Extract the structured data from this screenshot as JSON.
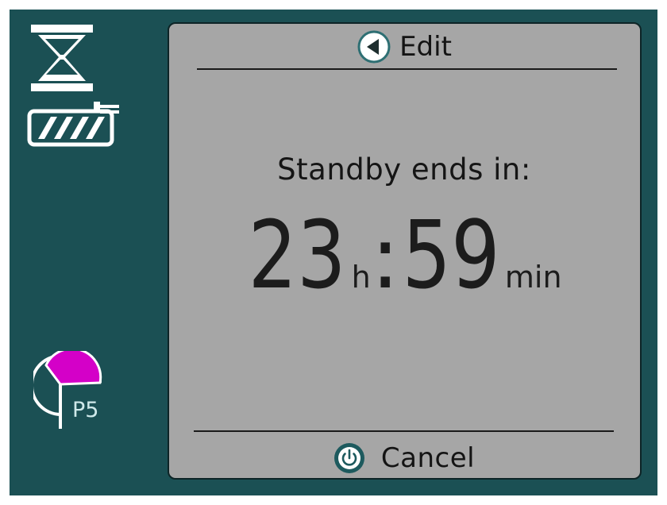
{
  "header": {
    "label": "Edit",
    "icon": "back-arrow-icon"
  },
  "standby": {
    "label": "Standby ends in:"
  },
  "timer": {
    "hours": "23",
    "hours_unit": "h",
    "separator": ":",
    "minutes": "59",
    "minutes_unit": "min"
  },
  "footer": {
    "label": "Cancel",
    "icon": "power-icon"
  },
  "status_icons": {
    "top": "hourglass-icon",
    "middle": "battery-icon",
    "bottom": "program-profile-icon"
  },
  "profile": {
    "label": "P5"
  },
  "colors": {
    "frame": "#1b5054",
    "panel": "#a6a6a6",
    "accent": "#d400c8",
    "icon_white": "#ffffff"
  }
}
